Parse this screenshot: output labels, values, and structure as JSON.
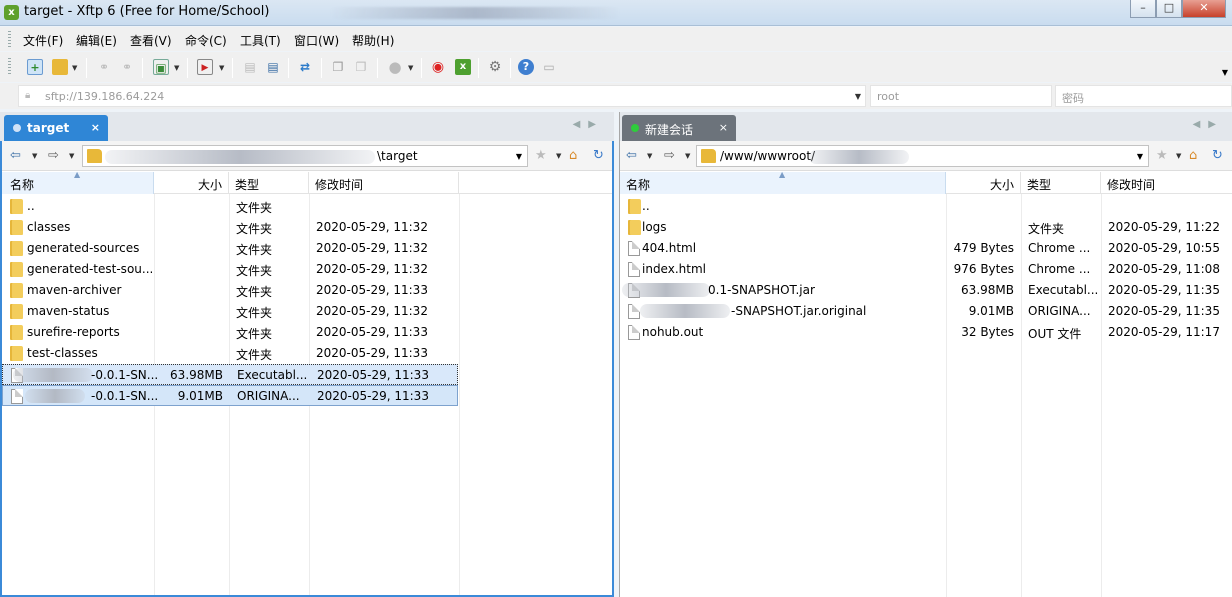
{
  "window": {
    "title": "target - Xftp 6 (Free for Home/School)",
    "minimize": "–",
    "maximize": "□",
    "close": "✕"
  },
  "menu": [
    "文件(F)",
    "编辑(E)",
    "查看(V)",
    "命令(C)",
    "工具(T)",
    "窗口(W)",
    "帮助(H)"
  ],
  "address": {
    "url": "sftp://139.186.64.224",
    "username_placeholder": "root",
    "password_placeholder": "密码"
  },
  "left_pane": {
    "tab_label": "target",
    "tab_close": "×",
    "path": "\\target",
    "columns": [
      "名称",
      "大小",
      "类型",
      "修改时间"
    ],
    "rows": [
      {
        "name": "..",
        "size": "",
        "type": "文件夹",
        "modified": "",
        "icon": "folder"
      },
      {
        "name": "classes",
        "size": "",
        "type": "文件夹",
        "modified": "2020-05-29, 11:32",
        "icon": "folder"
      },
      {
        "name": "generated-sources",
        "size": "",
        "type": "文件夹",
        "modified": "2020-05-29, 11:32",
        "icon": "folder"
      },
      {
        "name": "generated-test-sou...",
        "size": "",
        "type": "文件夹",
        "modified": "2020-05-29, 11:32",
        "icon": "folder"
      },
      {
        "name": "maven-archiver",
        "size": "",
        "type": "文件夹",
        "modified": "2020-05-29, 11:33",
        "icon": "folder"
      },
      {
        "name": "maven-status",
        "size": "",
        "type": "文件夹",
        "modified": "2020-05-29, 11:32",
        "icon": "folder"
      },
      {
        "name": "surefire-reports",
        "size": "",
        "type": "文件夹",
        "modified": "2020-05-29, 11:33",
        "icon": "folder"
      },
      {
        "name": "test-classes",
        "size": "",
        "type": "文件夹",
        "modified": "2020-05-29, 11:33",
        "icon": "folder"
      },
      {
        "name": "-0.0.1-SN...",
        "size": "63.98MB",
        "type": "Executabl...",
        "modified": "2020-05-29, 11:33",
        "icon": "file"
      },
      {
        "name": "-0.0.1-SN...",
        "size": "9.01MB",
        "type": "ORIGINA...",
        "modified": "2020-05-29, 11:33",
        "icon": "file"
      }
    ]
  },
  "right_pane": {
    "tab_label": "新建会话",
    "tab_close": "×",
    "path": "/www/wwwroot/",
    "columns": [
      "名称",
      "大小",
      "类型",
      "修改时间"
    ],
    "rows": [
      {
        "name": "..",
        "size": "",
        "type": "",
        "modified": "",
        "icon": "folder"
      },
      {
        "name": "logs",
        "size": "",
        "type": "文件夹",
        "modified": "2020-05-29, 11:22",
        "icon": "folder"
      },
      {
        "name": "404.html",
        "size": "479 Bytes",
        "type": "Chrome ...",
        "modified": "2020-05-29, 10:55",
        "icon": "file"
      },
      {
        "name": "index.html",
        "size": "976 Bytes",
        "type": "Chrome ...",
        "modified": "2020-05-29, 11:08",
        "icon": "file"
      },
      {
        "name": "0.1-SNAPSHOT.jar",
        "size": "63.98MB",
        "type": "Executabl...",
        "modified": "2020-05-29, 11:35",
        "icon": "file"
      },
      {
        "name": "-SNAPSHOT.jar.original",
        "size": "9.01MB",
        "type": "ORIGINA...",
        "modified": "2020-05-29, 11:35",
        "icon": "file"
      },
      {
        "name": "nohub.out",
        "size": "32 Bytes",
        "type": "OUT 文件",
        "modified": "2020-05-29, 11:17",
        "icon": "file"
      }
    ]
  }
}
